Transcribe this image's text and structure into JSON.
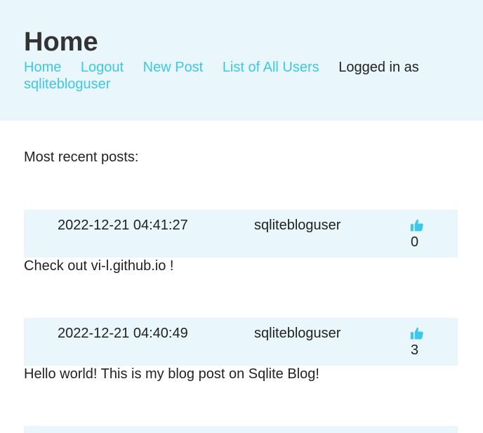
{
  "header": {
    "title": "Home",
    "nav": {
      "home": "Home",
      "logout": "Logout",
      "new_post": "New Post",
      "list_users": "List of All Users",
      "logged_in_as": "Logged in as",
      "username": "sqlitebloguser"
    }
  },
  "main": {
    "recent_label": "Most recent posts:",
    "posts": [
      {
        "date": "2022-12-21 04:41:27",
        "author": "sqlitebloguser",
        "likes": "0",
        "body": "Check out vi-l.github.io !",
        "like_icon": "thumbs-up-icon"
      },
      {
        "date": "2022-12-21 04:40:49",
        "author": "sqlitebloguser",
        "likes": "3",
        "body": "Hello world! This is my blog post on Sqlite Blog!",
        "like_icon": "thumbs-up-icon"
      }
    ]
  },
  "colors": {
    "accent": "#3cc8e8",
    "header_bg": "#e9f6fb"
  }
}
